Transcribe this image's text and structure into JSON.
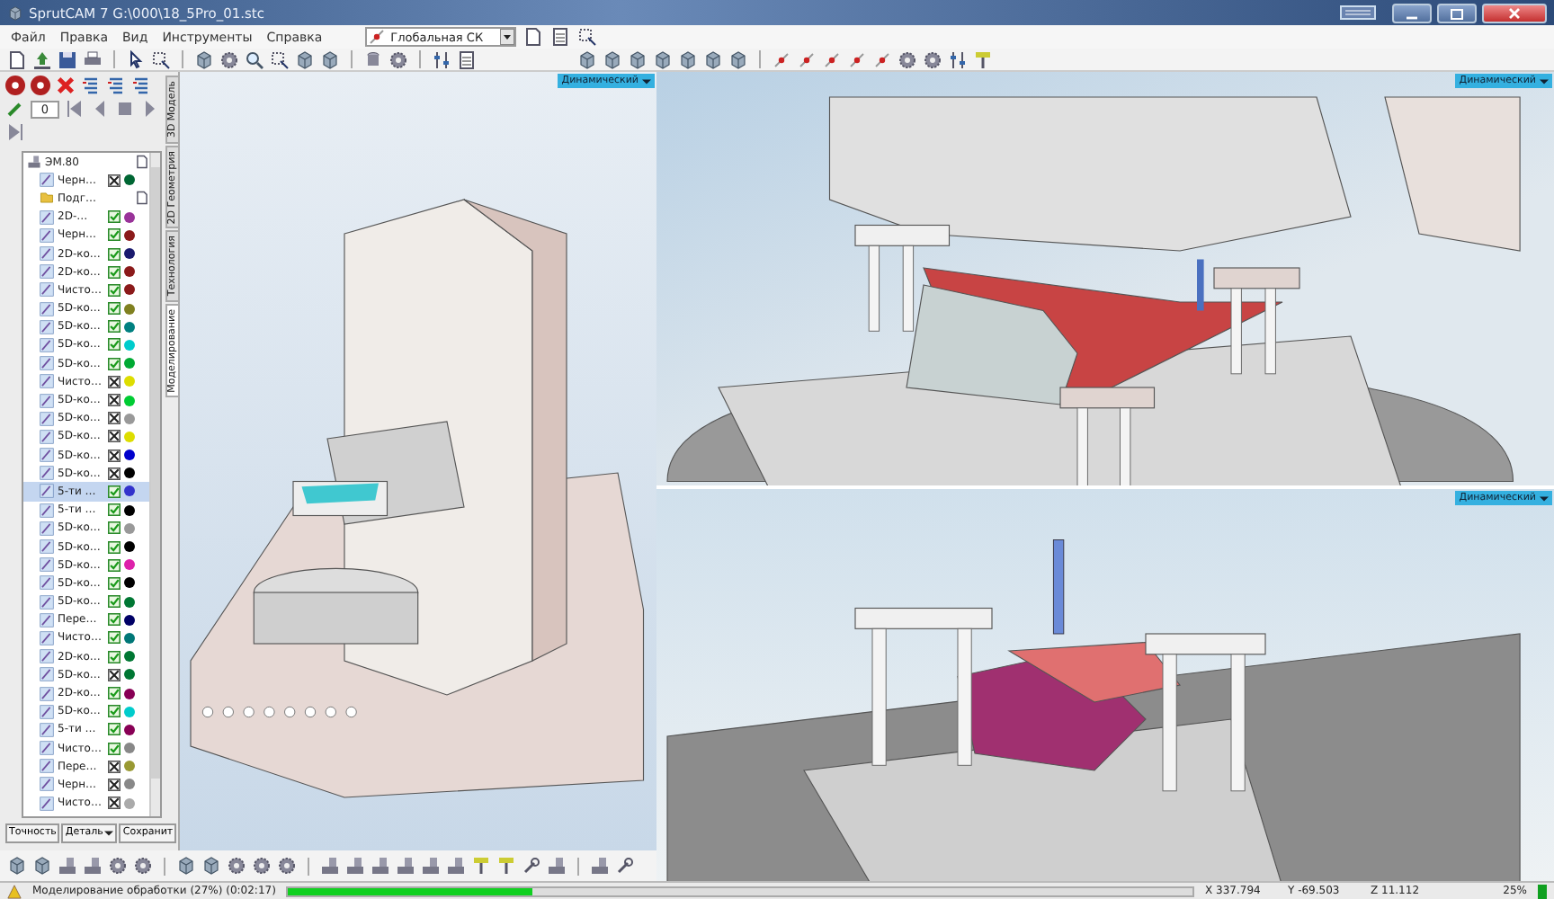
{
  "window": {
    "title": "SprutCAM 7  G:\\000\\18_5Pro_01.stc"
  },
  "menu": [
    "Файл",
    "Правка",
    "Вид",
    "Инструменты",
    "Справка"
  ],
  "coordinate_system": {
    "value": "Глобальная СК"
  },
  "side_tabs": [
    {
      "label": "3D Модель",
      "selected": false
    },
    {
      "label": "2D Геометрия",
      "selected": false
    },
    {
      "label": "Технология",
      "selected": false
    },
    {
      "label": "Моделирование",
      "selected": true
    }
  ],
  "simulation": {
    "step_value": "0"
  },
  "operations": {
    "label": "ЭМ.80",
    "children": [
      {
        "label": "Черн…",
        "kind": "operation",
        "checked": false,
        "color": "#006633",
        "selected": false
      },
      {
        "label": "Подг…",
        "kind": "folder",
        "selected": false
      },
      {
        "label": "2D-…",
        "kind": "operation",
        "checked": true,
        "color": "#993399",
        "selected": false
      },
      {
        "label": "Черн…",
        "kind": "operation",
        "checked": true,
        "color": "#8b1a1a",
        "selected": false
      },
      {
        "label": "2D-ко…",
        "kind": "operation",
        "checked": true,
        "color": "#1a1a6e",
        "selected": false
      },
      {
        "label": "2D-ко…",
        "kind": "operation",
        "checked": true,
        "color": "#8b1a1a",
        "selected": false
      },
      {
        "label": "Чисто…",
        "kind": "operation",
        "checked": true,
        "color": "#8b1a1a",
        "selected": false
      },
      {
        "label": "5D-ко…",
        "kind": "operation",
        "checked": true,
        "color": "#808020",
        "selected": false
      },
      {
        "label": "5D-ко…",
        "kind": "operation",
        "checked": true,
        "color": "#008080",
        "selected": false
      },
      {
        "label": "5D-ко…",
        "kind": "operation",
        "checked": true,
        "color": "#00cccc",
        "selected": false
      },
      {
        "label": "5D-ко…",
        "kind": "operation",
        "checked": true,
        "color": "#00aa33",
        "selected": false
      },
      {
        "label": "Чисто…",
        "kind": "operation",
        "checked": false,
        "color": "#dddd00",
        "selected": false
      },
      {
        "label": "5D-ко…",
        "kind": "operation",
        "checked": false,
        "color": "#00cc33",
        "selected": false
      },
      {
        "label": "5D-ко…",
        "kind": "operation",
        "checked": false,
        "color": "#999999",
        "selected": false
      },
      {
        "label": "5D-ко…",
        "kind": "operation",
        "checked": false,
        "color": "#dddd00",
        "selected": false
      },
      {
        "label": "5D-ко…",
        "kind": "operation",
        "checked": false,
        "color": "#0000cc",
        "selected": false
      },
      {
        "label": "5D-ко…",
        "kind": "operation",
        "checked": false,
        "color": "#000000",
        "selected": false
      },
      {
        "label": "5-ти …",
        "kind": "operation",
        "checked": true,
        "color": "#3333cc",
        "selected": true
      },
      {
        "label": "5-ти …",
        "kind": "operation",
        "checked": true,
        "color": "#000000",
        "selected": false
      },
      {
        "label": "5D-ко…",
        "kind": "operation",
        "checked": true,
        "color": "#999999",
        "selected": false
      },
      {
        "label": "5D-ко…",
        "kind": "operation",
        "checked": true,
        "color": "#000000",
        "selected": false
      },
      {
        "label": "5D-ко…",
        "kind": "operation",
        "checked": true,
        "color": "#dd22aa",
        "selected": false
      },
      {
        "label": "5D-ко…",
        "kind": "operation",
        "checked": true,
        "color": "#000000",
        "selected": false
      },
      {
        "label": "5D-ко…",
        "kind": "operation",
        "checked": true,
        "color": "#007733",
        "selected": false
      },
      {
        "label": "Пере…",
        "kind": "operation",
        "checked": true,
        "color": "#000066",
        "selected": false
      },
      {
        "label": "Чисто…",
        "kind": "operation",
        "checked": true,
        "color": "#007777",
        "selected": false
      },
      {
        "label": "2D-ко…",
        "kind": "operation",
        "checked": true,
        "color": "#007733",
        "selected": false
      },
      {
        "label": "5D-ко…",
        "kind": "operation",
        "checked": false,
        "color": "#007733",
        "selected": false
      },
      {
        "label": "2D-ко…",
        "kind": "operation",
        "checked": true,
        "color": "#880055",
        "selected": false
      },
      {
        "label": "5D-ко…",
        "kind": "operation",
        "checked": true,
        "color": "#00cccc",
        "selected": false
      },
      {
        "label": "5-ти …",
        "kind": "operation",
        "checked": true,
        "color": "#880055",
        "selected": false
      },
      {
        "label": "Чисто…",
        "kind": "operation",
        "checked": true,
        "color": "#888888",
        "selected": false
      },
      {
        "label": "Пере…",
        "kind": "operation",
        "checked": false,
        "color": "#999933",
        "selected": false
      },
      {
        "label": "Черн…",
        "kind": "operation",
        "checked": false,
        "color": "#888888",
        "selected": false
      },
      {
        "label": "Чисто…",
        "kind": "operation",
        "checked": false,
        "color": "#aaaaaa",
        "selected": false
      }
    ]
  },
  "panel_buttons": [
    {
      "label": "Точность",
      "kind": "button"
    },
    {
      "label": "Деталь",
      "kind": "dropdown"
    },
    {
      "label": "Сохранит",
      "kind": "button"
    }
  ],
  "viewports": [
    {
      "label": "Динамический",
      "kind": "machine"
    },
    {
      "label": "Динамический",
      "kind": "closeup"
    },
    {
      "label": "Динамический",
      "kind": "closeup_low"
    }
  ],
  "status_bar": {
    "message": "Моделирование обработки (27%) (0:02:17)",
    "progress": {
      "level": 0.27
    },
    "coords": [
      "X 337.794",
      "Y -69.503",
      "Z 11.112"
    ],
    "zoom": "25%"
  }
}
